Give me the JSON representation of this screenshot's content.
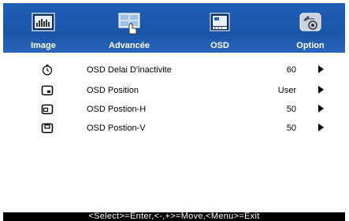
{
  "tabs": [
    {
      "label": "Image",
      "icon": "image-icon",
      "active": false
    },
    {
      "label": "Advancée",
      "icon": "advanced-icon",
      "active": false
    },
    {
      "label": "OSD",
      "icon": "osd-icon",
      "active": true
    },
    {
      "label": "Option",
      "icon": "option-icon",
      "active": false
    }
  ],
  "items": [
    {
      "label": "OSD Delai D'inactivite",
      "value": "60",
      "icon": "timer-icon"
    },
    {
      "label": "OSD Position",
      "value": "User",
      "icon": "osd-position-icon"
    },
    {
      "label": "OSD Postion-H",
      "value": "50",
      "icon": "osd-position-h-icon"
    },
    {
      "label": "OSD Postion-V",
      "value": "50",
      "icon": "osd-position-v-icon"
    }
  ],
  "footer": {
    "hint": "<Select>=Enter,<-,+>=Move,<Menu>=Exit"
  },
  "colors": {
    "topbar": "#1f5fb8",
    "footer": "#000000"
  }
}
